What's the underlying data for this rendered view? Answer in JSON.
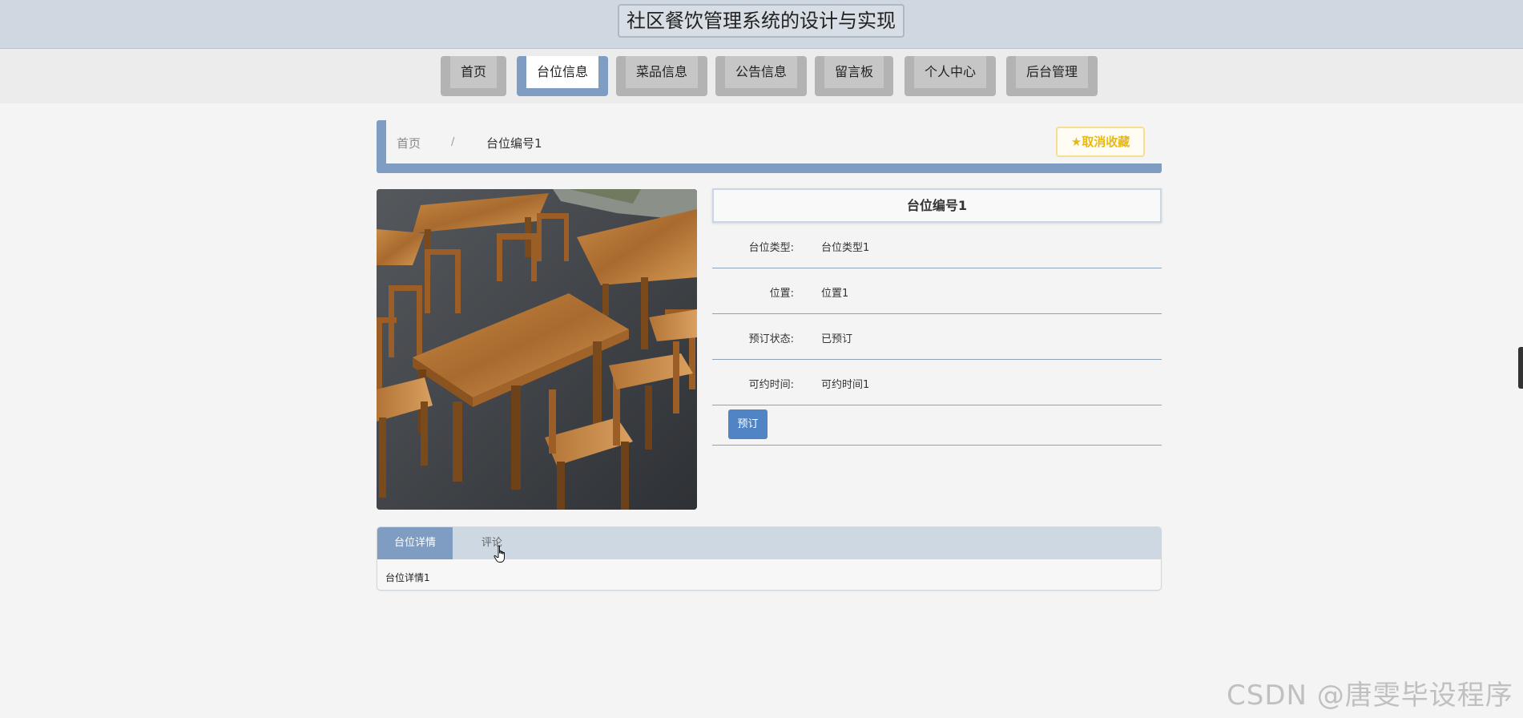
{
  "header": {
    "title": "社区餐饮管理系统的设计与实现"
  },
  "nav": {
    "items": [
      {
        "label": "首页"
      },
      {
        "label": "台位信息"
      },
      {
        "label": "菜品信息"
      },
      {
        "label": "公告信息"
      },
      {
        "label": "留言板"
      },
      {
        "label": "个人中心"
      },
      {
        "label": "后台管理"
      }
    ],
    "active_index": 1
  },
  "breadcrumb": {
    "home": "首页",
    "separator": "/",
    "current": "台位编号1"
  },
  "favorite": {
    "icon": "star-icon",
    "label": "取消收藏"
  },
  "detail": {
    "title": "台位编号1",
    "fields": [
      {
        "label": "台位类型:",
        "value": "台位类型1"
      },
      {
        "label": "位置:",
        "value": "位置1"
      },
      {
        "label": "预订状态:",
        "value": "已预订"
      },
      {
        "label": "可约时间:",
        "value": "可约时间1"
      }
    ],
    "book_label": "预订"
  },
  "tabs": {
    "items": [
      {
        "label": "台位详情"
      },
      {
        "label": "评论"
      }
    ],
    "active_index": 0,
    "content": "台位详情1"
  },
  "watermark": "CSDN @唐雯毕设程序",
  "colors": {
    "accent": "#7f9dc3",
    "primary_button": "#5084c4",
    "favorite": "#e8b813",
    "header_bg": "#cfd8e0"
  }
}
